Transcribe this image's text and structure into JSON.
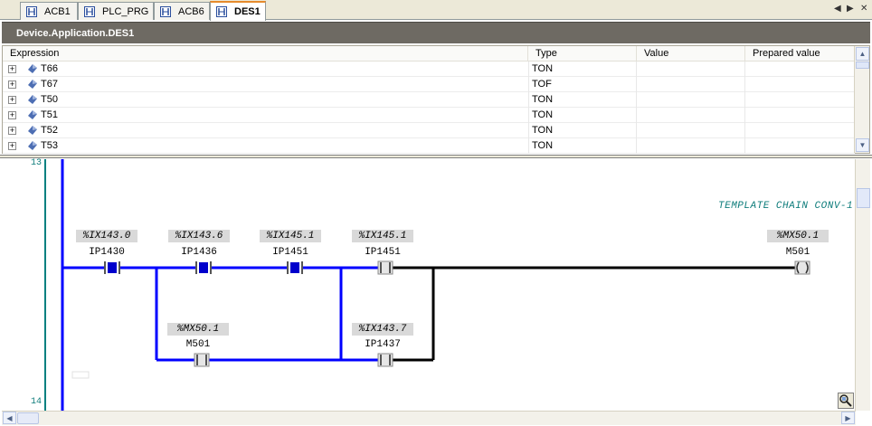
{
  "tabs": [
    {
      "label": "ACB1",
      "active": false
    },
    {
      "label": "PLC_PRG",
      "active": false
    },
    {
      "label": "ACB6",
      "active": false
    },
    {
      "label": "DES1",
      "active": true
    }
  ],
  "tab_nav": {
    "menu": "◂",
    "prev": "◀",
    "next": "▶",
    "close": "✕"
  },
  "title": "Device.Application.DES1",
  "watch": {
    "columns": [
      "Expression",
      "Type",
      "Value",
      "Prepared value"
    ],
    "rows": [
      {
        "expression": "T66",
        "type": "TON",
        "value": "",
        "prepared": ""
      },
      {
        "expression": "T67",
        "type": "TOF",
        "value": "",
        "prepared": ""
      },
      {
        "expression": "T50",
        "type": "TON",
        "value": "",
        "prepared": ""
      },
      {
        "expression": "T51",
        "type": "TON",
        "value": "",
        "prepared": ""
      },
      {
        "expression": "T52",
        "type": "TON",
        "value": "",
        "prepared": ""
      },
      {
        "expression": "T53",
        "type": "TON",
        "value": "",
        "prepared": ""
      }
    ]
  },
  "ladder": {
    "rung_numbers": [
      "13",
      "14"
    ],
    "comment": "TEMPLATE CHAIN CONV-1",
    "contacts": [
      {
        "address": "%IX143.0",
        "name": "IP1430",
        "state": "closed"
      },
      {
        "address": "%IX143.6",
        "name": "IP1436",
        "state": "closed"
      },
      {
        "address": "%IX145.1",
        "name": "IP1451",
        "state": "closed"
      },
      {
        "address": "%IX145.1",
        "name": "IP1451",
        "state": "open"
      },
      {
        "address": "%MX50.1",
        "name": "M501",
        "state": "open"
      },
      {
        "address": "%IX143.7",
        "name": "IP1437",
        "state": "open"
      }
    ],
    "coil": {
      "address": "%MX50.1",
      "name": "M501"
    },
    "colors": {
      "energized": "#0000ff",
      "deenergized": "#000000",
      "rail": "#008080"
    }
  }
}
